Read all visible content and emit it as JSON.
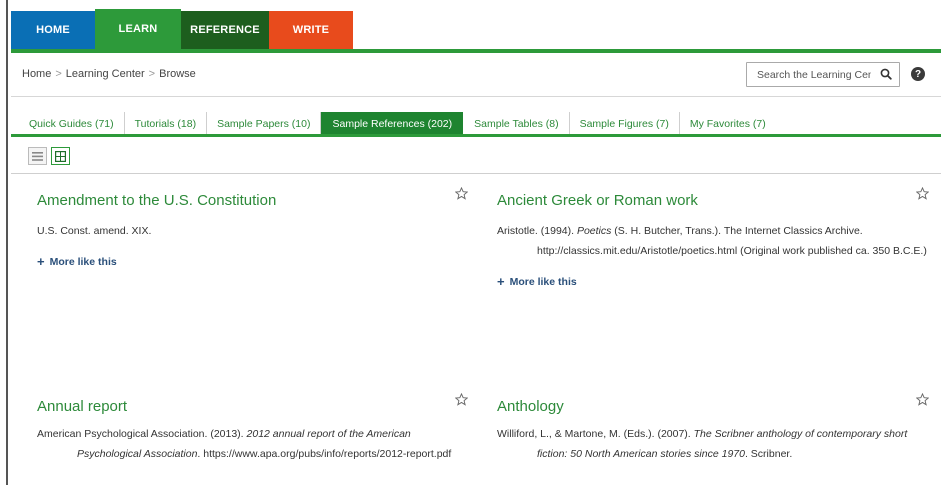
{
  "nav": {
    "home": "HOME",
    "learn": "LEARN",
    "reference": "REFERENCE",
    "write": "WRITE"
  },
  "colors": {
    "home": "#0a6fb5",
    "learn": "#2d9a3a",
    "reference": "#1d5e1e",
    "write": "#e84b1c",
    "link_green": "#2d8a3a",
    "more_link": "#2a4f7a"
  },
  "breadcrumb": {
    "items": [
      "Home",
      "Learning Center",
      "Browse"
    ],
    "separator": ">"
  },
  "search": {
    "placeholder": "Search the Learning Center",
    "icon": "search-icon"
  },
  "help": {
    "label": "?"
  },
  "tabs": [
    {
      "label": "Quick Guides (71)"
    },
    {
      "label": "Tutorials (18)"
    },
    {
      "label": "Sample Papers (10)"
    },
    {
      "label": "Sample References (202)",
      "active": true
    },
    {
      "label": "Sample Tables (8)"
    },
    {
      "label": "Sample Figures (7)"
    },
    {
      "label": "My Favorites (7)"
    }
  ],
  "view": {
    "modes": [
      "list-view-icon",
      "grid-view-icon"
    ],
    "selected": "grid-view-icon"
  },
  "cards": [
    {
      "title": "Amendment to the U.S. Constitution",
      "ref_plain": "U.S. Const. amend. XIX.",
      "more": "More like this"
    },
    {
      "title": "Ancient Greek or Roman work",
      "ref_a": "Aristotle. (1994). ",
      "ref_i": "Poetics",
      "ref_b": " (S. H. Butcher, Trans.). The Internet Classics Archive. http://classics.mit.edu/Aristotle/poetics.html (Original work published ca. 350 B.C.E.)",
      "more": "More like this"
    },
    {
      "title": "Annual report",
      "ref_a": "American Psychological Association. (2013). ",
      "ref_i": "2012 annual report of the American Psychological Association",
      "ref_b": ". https://www.apa.org/pubs/info/reports/2012-report.pdf"
    },
    {
      "title": "Anthology",
      "ref_a": "Williford, L., & Martone, M. (Eds.). (2007). ",
      "ref_i": "The Scribner anthology of contemporary short fiction: 50 North American stories since 1970",
      "ref_b": ". Scribner."
    }
  ]
}
